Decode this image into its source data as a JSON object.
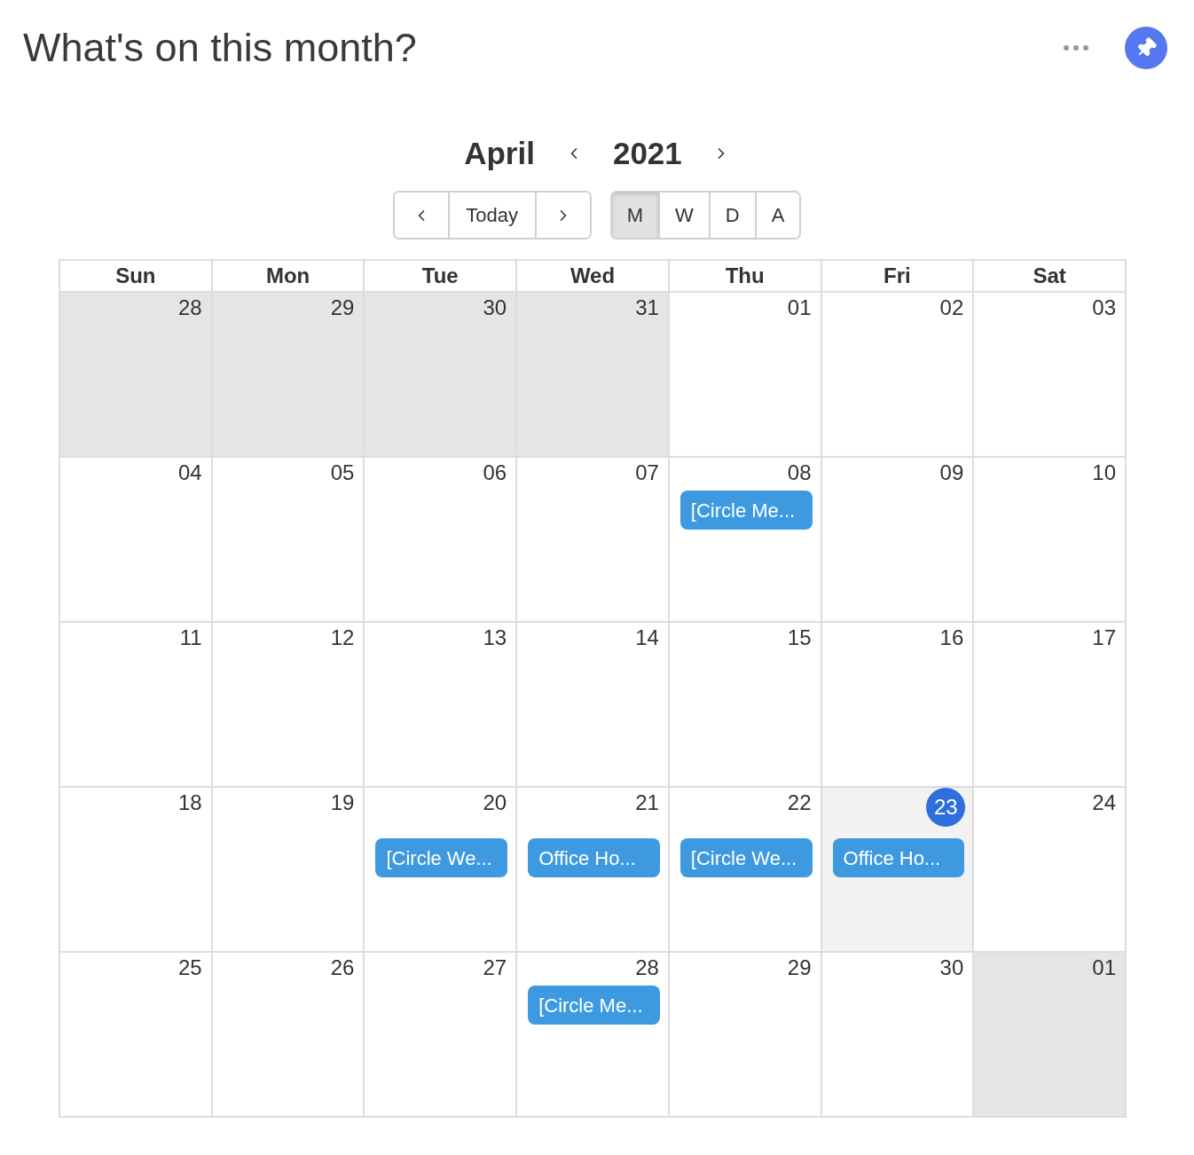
{
  "header": {
    "title": "What's on this month?"
  },
  "calendar": {
    "month": "April",
    "year": "2021",
    "today_button": "Today",
    "views": [
      {
        "label": "M",
        "selected": true
      },
      {
        "label": "W",
        "selected": false
      },
      {
        "label": "D",
        "selected": false
      },
      {
        "label": "A",
        "selected": false
      }
    ],
    "weekdays": [
      "Sun",
      "Mon",
      "Tue",
      "Wed",
      "Thu",
      "Fri",
      "Sat"
    ],
    "weeks": [
      {
        "days": [
          {
            "date": "28",
            "outside_month": true,
            "today": false
          },
          {
            "date": "29",
            "outside_month": true,
            "today": false
          },
          {
            "date": "30",
            "outside_month": true,
            "today": false
          },
          {
            "date": "31",
            "outside_month": true,
            "today": false
          },
          {
            "date": "01",
            "outside_month": false,
            "today": false
          },
          {
            "date": "02",
            "outside_month": false,
            "today": false
          },
          {
            "date": "03",
            "outside_month": false,
            "today": false
          }
        ]
      },
      {
        "days": [
          {
            "date": "04",
            "outside_month": false,
            "today": false
          },
          {
            "date": "05",
            "outside_month": false,
            "today": false
          },
          {
            "date": "06",
            "outside_month": false,
            "today": false
          },
          {
            "date": "07",
            "outside_month": false,
            "today": false
          },
          {
            "date": "08",
            "outside_month": false,
            "today": false,
            "events": [
              "[Circle Me..."
            ]
          },
          {
            "date": "09",
            "outside_month": false,
            "today": false
          },
          {
            "date": "10",
            "outside_month": false,
            "today": false
          }
        ]
      },
      {
        "days": [
          {
            "date": "11",
            "outside_month": false,
            "today": false
          },
          {
            "date": "12",
            "outside_month": false,
            "today": false
          },
          {
            "date": "13",
            "outside_month": false,
            "today": false
          },
          {
            "date": "14",
            "outside_month": false,
            "today": false
          },
          {
            "date": "15",
            "outside_month": false,
            "today": false
          },
          {
            "date": "16",
            "outside_month": false,
            "today": false
          },
          {
            "date": "17",
            "outside_month": false,
            "today": false
          }
        ]
      },
      {
        "days": [
          {
            "date": "18",
            "outside_month": false,
            "today": false
          },
          {
            "date": "19",
            "outside_month": false,
            "today": false
          },
          {
            "date": "20",
            "outside_month": false,
            "today": false,
            "events": [
              "[Circle We..."
            ]
          },
          {
            "date": "21",
            "outside_month": false,
            "today": false,
            "events": [
              "Office Ho..."
            ]
          },
          {
            "date": "22",
            "outside_month": false,
            "today": false,
            "events": [
              "[Circle We..."
            ]
          },
          {
            "date": "23",
            "outside_month": false,
            "today": true,
            "events": [
              "Office Ho..."
            ]
          },
          {
            "date": "24",
            "outside_month": false,
            "today": false
          }
        ]
      },
      {
        "days": [
          {
            "date": "25",
            "outside_month": false,
            "today": false
          },
          {
            "date": "26",
            "outside_month": false,
            "today": false
          },
          {
            "date": "27",
            "outside_month": false,
            "today": false
          },
          {
            "date": "28",
            "outside_month": false,
            "today": false,
            "events": [
              "[Circle Me..."
            ]
          },
          {
            "date": "29",
            "outside_month": false,
            "today": false
          },
          {
            "date": "30",
            "outside_month": false,
            "today": false
          },
          {
            "date": "01",
            "outside_month": true,
            "today": false
          }
        ]
      }
    ]
  }
}
